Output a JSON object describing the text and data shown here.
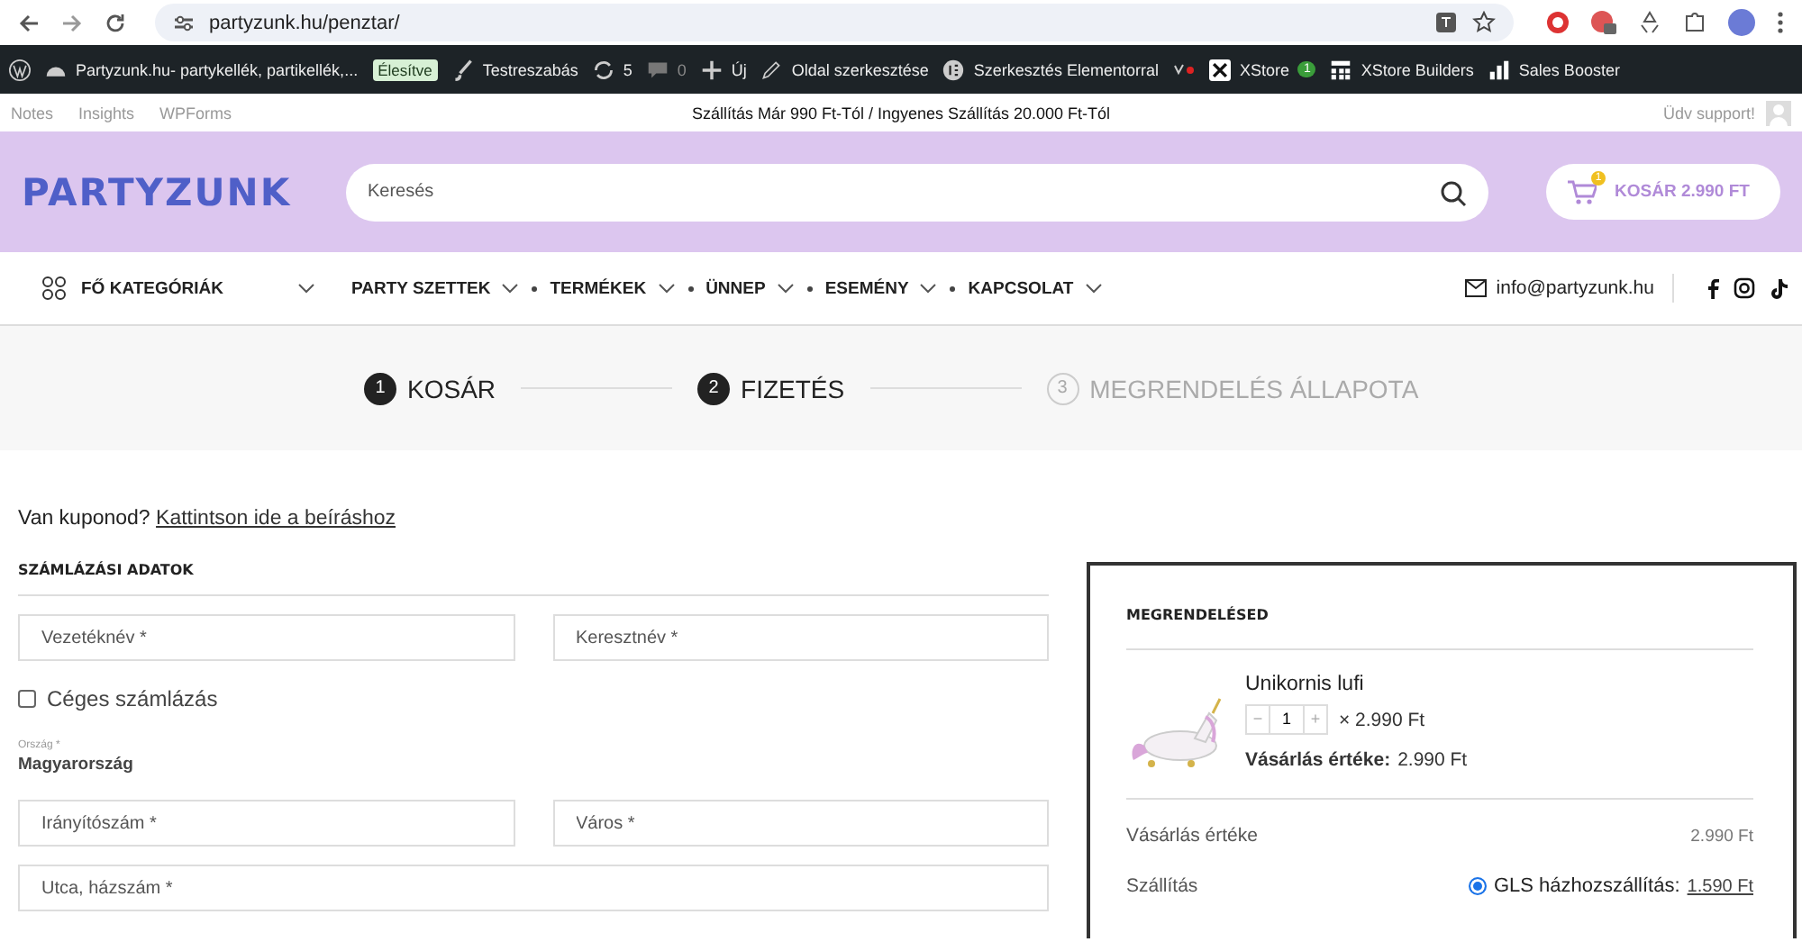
{
  "browser": {
    "url": "partyzunk.hu/penztar/"
  },
  "admin_bar": {
    "items": [
      {
        "kind": "icon"
      },
      {
        "label": "Partyzunk.hu- partykellék, partikellék,..."
      },
      {
        "label": "Élesítve",
        "kind": "badge"
      },
      {
        "label": "Testreszabás"
      },
      {
        "label": "5"
      },
      {
        "label": "0"
      },
      {
        "label": "Új"
      },
      {
        "label": "Oldal szerkesztése"
      },
      {
        "label": "Szerkesztés Elementorral"
      },
      {
        "kind": "icon"
      },
      {
        "label": "XStore",
        "count": "1"
      },
      {
        "label": "XStore Builders"
      },
      {
        "label": "Sales Booster"
      }
    ]
  },
  "sub_bar": {
    "faded_items": [
      "Notes",
      "Insights",
      "WPForms"
    ],
    "announcement": "Szállítás Már 990 Ft-Tól / Ingyenes Szállítás 20.000 Ft-Tól",
    "greeting": "Üdv support!"
  },
  "header": {
    "logo": "PARTYZUNK",
    "search": {
      "placeholder": "Keresés"
    },
    "cart": {
      "count": "1",
      "label": "KOSÁR 2.990 FT"
    }
  },
  "nav": {
    "categories": "FŐ KATEGÓRIÁK",
    "items": [
      "PARTY SZETTEK",
      "TERMÉKEK",
      "ÜNNEP",
      "ESEMÉNY",
      "KAPCSOLAT"
    ],
    "email": "info@partyzunk.hu"
  },
  "steps": [
    {
      "number": "1",
      "label": "KOSÁR",
      "reached": true
    },
    {
      "number": "2",
      "label": "FIZETÉS",
      "reached": true
    },
    {
      "number": "3",
      "label": "MEGRENDELÉS ÁLLAPOTA",
      "reached": false
    }
  ],
  "coupon": {
    "text": "Van kuponod?",
    "link": "Kattintson ide a beíráshoz"
  },
  "billing": {
    "title": "SZÁMLÁZÁSI ADATOK",
    "name_fields": [
      {
        "placeholder": "Vezetéknév *"
      },
      {
        "placeholder": "Keresztnév *"
      }
    ],
    "company_checkbox": {
      "label": "Céges számlázás",
      "checked": false
    },
    "country": {
      "label": "Ország *",
      "value": "Magyarország"
    },
    "city_fields": [
      {
        "placeholder": "Irányítószám *"
      },
      {
        "placeholder": "Város *"
      }
    ],
    "street_field": {
      "placeholder": "Utca, házszám *"
    }
  },
  "order": {
    "title": "MEGRENDELÉSED",
    "product": {
      "name": "Unikornis lufi",
      "minus": "−",
      "quantity": "1",
      "plus": "+",
      "price": "× 2.990 Ft",
      "subtotal_label": "Vásárlás értéke:",
      "subtotal": "2.990 Ft"
    },
    "totals": [
      {
        "label": "Vásárlás értéke",
        "value": "2.990 Ft"
      }
    ],
    "shipping": {
      "label": "Szállítás",
      "options": [
        {
          "label": "GLS házhozszállítás:",
          "price": "1.590 Ft",
          "selected": true
        }
      ]
    }
  }
}
